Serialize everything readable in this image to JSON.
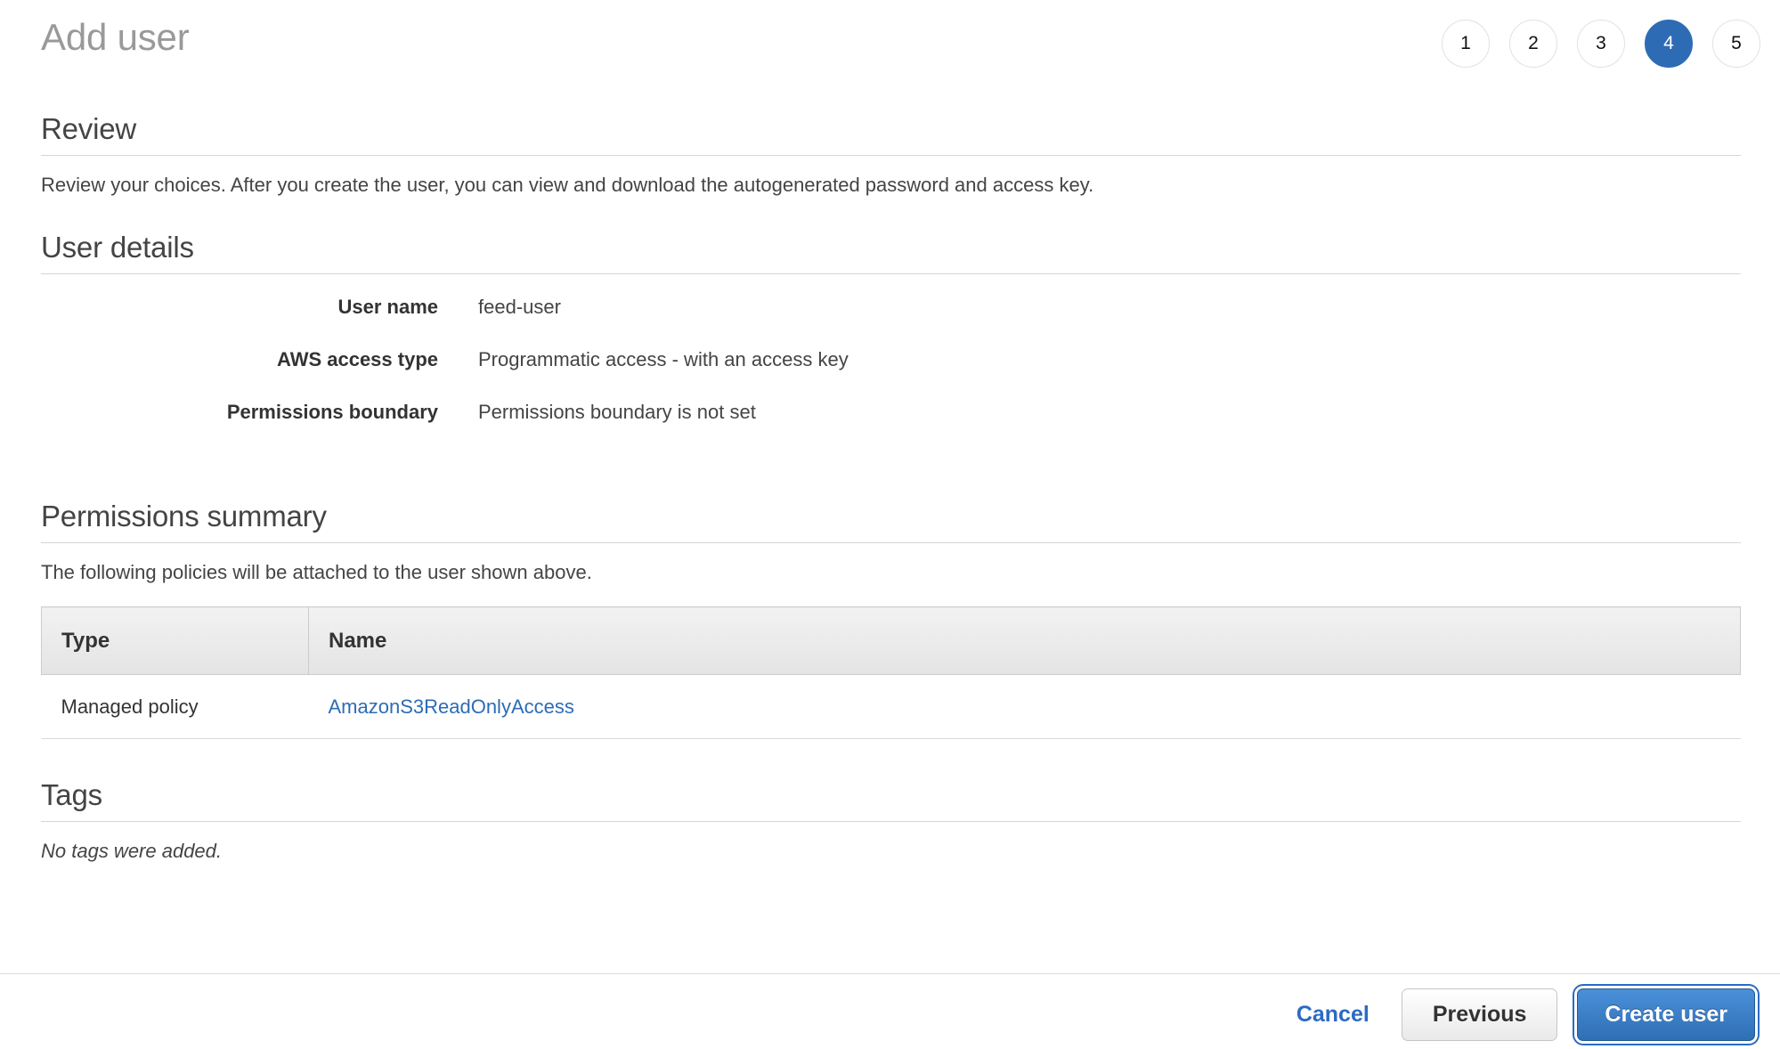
{
  "header": {
    "title": "Add user",
    "steps": [
      {
        "label": "1",
        "active": false
      },
      {
        "label": "2",
        "active": false
      },
      {
        "label": "3",
        "active": false
      },
      {
        "label": "4",
        "active": true
      },
      {
        "label": "5",
        "active": false
      }
    ]
  },
  "review": {
    "heading": "Review",
    "description": "Review your choices. After you create the user, you can view and download the autogenerated password and access key."
  },
  "user_details": {
    "heading": "User details",
    "rows": [
      {
        "label": "User name",
        "value": "feed-user"
      },
      {
        "label": "AWS access type",
        "value": "Programmatic access - with an access key"
      },
      {
        "label": "Permissions boundary",
        "value": "Permissions boundary is not set"
      }
    ]
  },
  "permissions_summary": {
    "heading": "Permissions summary",
    "description": "The following policies will be attached to the user shown above.",
    "table": {
      "columns": [
        "Type",
        "Name"
      ],
      "rows": [
        {
          "type": "Managed policy",
          "name": "AmazonS3ReadOnlyAccess"
        }
      ]
    }
  },
  "tags": {
    "heading": "Tags",
    "empty_text": "No tags were added."
  },
  "footer": {
    "cancel_label": "Cancel",
    "previous_label": "Previous",
    "create_label": "Create user"
  },
  "colors": {
    "accent_blue": "#2d6cb5",
    "link_blue": "#2a6bc4",
    "title_gray": "#999999",
    "text_gray": "#444444",
    "divider": "#d5d5d5"
  }
}
